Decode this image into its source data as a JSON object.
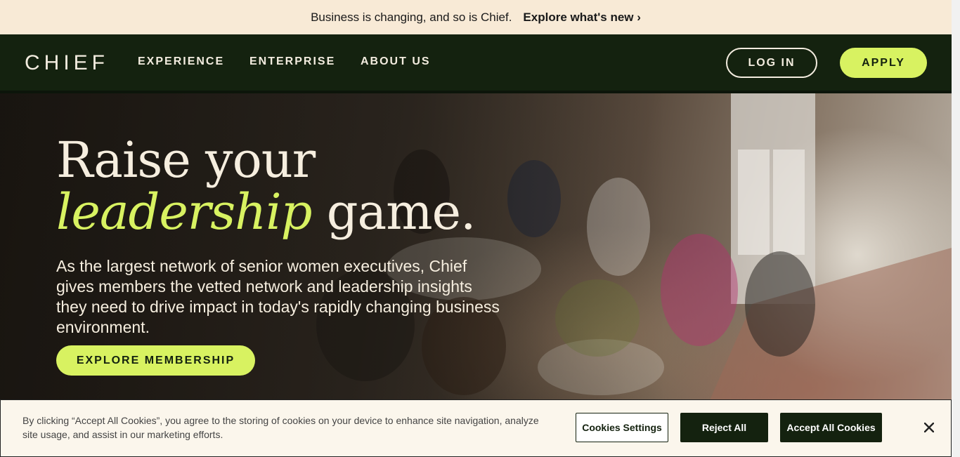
{
  "announcement": {
    "text": "Business is changing, and so is Chief.",
    "link": "Explore what's new ›"
  },
  "nav": {
    "logo": "CHIEF",
    "links": [
      "EXPERIENCE",
      "ENTERPRISE",
      "ABOUT US"
    ],
    "login": "LOG IN",
    "apply": "APPLY"
  },
  "hero": {
    "headline_line1": "Raise your",
    "headline_accent": "leadership",
    "headline_rest": "game.",
    "body": "As the largest network of senior women executives, Chief gives members the vetted network and leadership insights they need to drive impact in today's rapidly changing business environment.",
    "cta": "EXPLORE MEMBERSHIP"
  },
  "cookie_banner": {
    "text": "By clicking “Accept All Cookies”, you agree to the storing of cookies on your device to enhance site navigation, analyze site usage, and assist in our marketing efforts.",
    "settings": "Cookies Settings",
    "reject": "Reject All",
    "accept": "Accept All Cookies",
    "close_icon": "close-icon"
  },
  "colors": {
    "announcement_bg": "#f8ead6",
    "nav_bg": "#14220f",
    "accent": "#d8f261",
    "cream_text": "#f6eedf",
    "cookie_bg": "#fbf6ec"
  }
}
